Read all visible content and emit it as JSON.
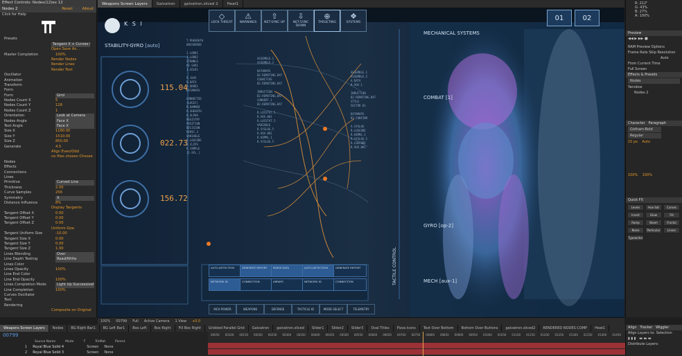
{
  "left_panel": {
    "tab": "Effect Controls: Nodes(12)ex 12",
    "layer": "Nodes 2",
    "reset": "Reset",
    "about": "About",
    "click_help": "Click for Help",
    "rows": [
      {
        "label": "Presets",
        "value": ""
      },
      {
        "label": "",
        "value": "Tangent X + Curves Oscillator",
        "select": true
      },
      {
        "label": "",
        "value": "Open      Save As..."
      },
      {
        "label": "Master Completion",
        "value": "100%"
      },
      {
        "label": "",
        "value": "Render Nodes"
      },
      {
        "label": "",
        "value": "Render Lines"
      },
      {
        "label": "",
        "value": "Render Text"
      },
      {
        "label": "Oscillator",
        "value": ""
      },
      {
        "label": "Animation",
        "value": ""
      },
      {
        "label": "Transform",
        "value": ""
      },
      {
        "label": "Form",
        "value": ""
      },
      {
        "label": "Form",
        "value": "Grid",
        "select": true
      },
      {
        "label": "Nodes Count X",
        "value": "5"
      },
      {
        "label": "Nodes Count Y",
        "value": "128"
      },
      {
        "label": "Nodes Count Z",
        "value": "1"
      },
      {
        "label": "Orientation",
        "value": "Look at Camera",
        "select": true
      },
      {
        "label": "Nodes Angle",
        "value": "Face X",
        "select": true
      },
      {
        "label": "Text Angle",
        "value": "Face X",
        "select": true
      },
      {
        "label": "Size X",
        "value": "1160.00"
      },
      {
        "label": "Size Y",
        "value": "1510.00"
      },
      {
        "label": "Size Z",
        "value": "850.00"
      },
      {
        "label": "Generate",
        "value": "4.5"
      },
      {
        "label": "",
        "value": "Align Even/Odd"
      },
      {
        "label": "",
        "value": "no files chosen     Choose"
      },
      {
        "label": "Nodes",
        "value": ""
      },
      {
        "label": "Effects",
        "value": ""
      },
      {
        "label": "Connections",
        "value": ""
      },
      {
        "label": "Lines",
        "value": ""
      },
      {
        "label": "Primitive",
        "value": "Curved Line",
        "select": true
      },
      {
        "label": "Thickness",
        "value": "2.00"
      },
      {
        "label": "Curve Samples",
        "value": "256"
      },
      {
        "label": "Symmetry",
        "value": "X",
        "select": true
      },
      {
        "label": "Distance Influence",
        "value": "8%"
      },
      {
        "label": "",
        "value": "Display Tangents"
      },
      {
        "label": "Tangent Offset X",
        "value": "0.00"
      },
      {
        "label": "Tangent Offset Y",
        "value": "0.00"
      },
      {
        "label": "Tangent Offset Z",
        "value": "0.00"
      },
      {
        "label": "",
        "value": "Uniform Size"
      },
      {
        "label": "Tangent Uniform Size",
        "value": "-10.00"
      },
      {
        "label": "Tangent Size X",
        "value": "0.00"
      },
      {
        "label": "Tangent Size Y",
        "value": "0.00"
      },
      {
        "label": "Tangent Size Z",
        "value": "1.00"
      },
      {
        "label": "Lines Blending",
        "value": "Over",
        "select": true
      },
      {
        "label": "Line Depth Testing",
        "value": "Read/Write",
        "select": true
      },
      {
        "label": "Lines Color",
        "value": ""
      },
      {
        "label": "Lines Opacity",
        "value": "100%"
      },
      {
        "label": "Line End Color",
        "value": ""
      },
      {
        "label": "Line End Opacity",
        "value": "100%"
      },
      {
        "label": "Lines Completion Mode",
        "value": "Light Up Successively",
        "select": true
      },
      {
        "label": "Line Completion",
        "value": "100%"
      },
      {
        "label": "Curves Oscillator",
        "value": ""
      },
      {
        "label": "Text",
        "value": ""
      },
      {
        "label": "Rendering",
        "value": ""
      },
      {
        "label": "",
        "value": "Composite on Original"
      }
    ]
  },
  "comp_tabs": [
    "Weapons Screen Layers",
    "Galvatron",
    "galvatron.sliced 2",
    "Heat1"
  ],
  "hud": {
    "brand": "K S I",
    "top_buttons": [
      "LOCK THREAT",
      "WARNINGS",
      "NET-SYNC UP",
      "NET-SYNC DOWN",
      "TARGETING",
      "SYSTEMS"
    ],
    "stability_label": "STABILITY-GYRO",
    "stability_tag": "[auto]",
    "values": [
      "115.04",
      "022.73",
      "156.72"
    ],
    "mech_title": "MECHANICAL SYSTEMS",
    "combat": "COMBAT [1]",
    "gyro": "GYRO [op-2]",
    "mech": "MECH [aux-1]",
    "tactile": "TACTILE CONTROL",
    "panel_nums": [
      "01",
      "02"
    ],
    "bottom_tabs": [
      "MCH POWER",
      "WEAPONS",
      "DEFENSE",
      "TACTICLE ID",
      "MODE SELECT",
      "TELEMETRY"
    ],
    "grid_buttons": [
      "AUTO-DETECTION",
      "GENERATE REPORT",
      "PARSE DATA",
      "AUTO-DETECTION",
      "GENERATE REPORT",
      "NETWORK ID",
      "CONNECTION",
      "ARRAYS",
      "NETWORK ID",
      "CONNECTION"
    ],
    "left_col": "T.PHEADATH\nUNCOVERED\n\nI.LORD1\nI.LORD2\nSTUNNLE\nKI-SAR1\nI.SOLR1\n\nR.1945\nR.DATA\nI.ODRD1\nDATAMAPS\n\nCONNECTED\n[LOGIC]\nM.RAMMER\nR.SHEARTH\nB.ALPHA\nREGISTRY\nPOSITION\nDECISION\nMIMIC.3\nVARIABLE\nR.LOGCODE\nR.CLIPS\nR.COMPLE\n[1.9FL.]",
    "mid_col": "ASSEMBLE.1\nASSEMBLE.2\n\nDATAMAPS\nB2.REMOTING.DAT\nCOGNITIVE\nB2.REMOTING.DAT\n\nINDUCTION\nB2.REMOTING.DAT\nCONVERT.1\nB2.REMOTING.DAT\n\nR.LOCSTAT.5\nR.VOX.001\nR.LOCSTAT.5\nVARIABLE\nR.SYSLOG.5\nR.VOX.001\nR.HIMML.1\nR.SYSLOG.5",
    "right_col": "ASSEMBLE.1\nASSEMBLE.2\nA.DATA\nB.VOX.1\n\nINDUCTION\nB2.REMOTING.DAT\nSTYLE\nSECTOR 01\n\nDATAMAPS\nB2.CONFIRM\n\nA.SYSLOG\nR.LOGCODE\nR.HIMML.1\nR.SYSLOG.5\nR.LOGCODE\nR.VOX.001"
  },
  "right_panel": {
    "info": [
      "R: 212\"",
      "G: 43%",
      "B: 27%",
      "A: 100%",
      "X: 787",
      "Y: 360"
    ],
    "preview": "Preview",
    "ram_preview": "RAM Preview Options",
    "frame_rate": "Frame Rate",
    "skip": "Skip",
    "resolution": "Resolution",
    "res_val": "Auto",
    "from_current": "From Current Time",
    "full_screen": "Full Screen",
    "effects_presets": "Effects & Presets",
    "search": "Nodes",
    "tree": [
      "Yanobox",
      "Nodes 2"
    ],
    "character": "Character",
    "paragraph": "Paragraph",
    "font": "Gotham-Bold",
    "font_style": "Regular",
    "font_size": "15 px",
    "leading": "Auto",
    "scale_v": "100%",
    "scale_h": "100%",
    "quick_fx": "Quick FX",
    "qfx": [
      "Levels",
      "Hue Sat",
      "Curves",
      "Invert",
      "Glow",
      "Fill",
      "Ramp",
      "Beam",
      "Fractal",
      "Noise",
      "Particular",
      "Linear",
      "Typewriter"
    ]
  },
  "comp_bar": {
    "zoom": "100%",
    "timecode": "00799",
    "res": "Full",
    "camera": "Active Camera",
    "view": "1 View",
    "exposure": "+0.0"
  },
  "timeline_tabs": [
    "Weapons Screen Layers",
    "Nodes",
    "BG Right Bar1",
    "BG Left Bar1",
    "Box Left",
    "Box Right",
    "Fill Box Right",
    "Gridded Parallel Grid",
    "Galvatron",
    "galvatron.sliced",
    "Slider1",
    "Slider2",
    "Slider3",
    "Oval Titles",
    "Pizza Icons",
    "Text Over Bottom",
    "Bottom Over Buttons",
    "galvatron.sliced2",
    "RENDERED NODES COMP",
    "Heat1"
  ],
  "timeline": {
    "timecode": "00799",
    "columns": [
      "Source Name",
      "Mode",
      "T",
      "TrkMat",
      "Parent"
    ],
    "layers": [
      {
        "num": "1",
        "name": "Royal Blue Solid 4",
        "mode": "Screen",
        "trk": "None"
      },
      {
        "num": "2",
        "name": "Royal Blue Solid 3",
        "mode": "Screen",
        "trk": "None"
      }
    ],
    "ruler": [
      "00050",
      "00100",
      "00150",
      "00200",
      "00250",
      "00300",
      "00350",
      "00400",
      "00450",
      "00500",
      "00550",
      "00600",
      "00650",
      "00700",
      "00750",
      "00800",
      "00850",
      "00900",
      "00950",
      "01000",
      "01050",
      "01100",
      "01150",
      "01200",
      "01250",
      "01300",
      "01350",
      "01400",
      "01450"
    ]
  },
  "align_panel": {
    "title": "Align",
    "tracker": "Tracker",
    "wiggler": "Wiggler",
    "align_layers": "Align Layers to:",
    "selection": "Selection",
    "distribute": "Distribute Layers:"
  }
}
